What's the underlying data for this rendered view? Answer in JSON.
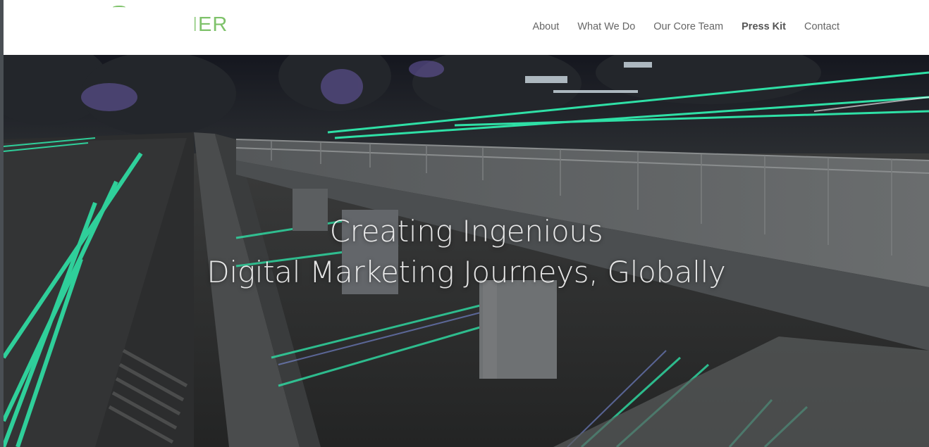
{
  "header": {
    "logo_text": "IER",
    "nav": [
      {
        "label": "About"
      },
      {
        "label": "What We Do"
      },
      {
        "label": "Our Core Team"
      },
      {
        "label": "Press Kit"
      },
      {
        "label": "Contact"
      }
    ]
  },
  "hero": {
    "line1": "Creating Ingenious",
    "line2": "Digital Marketing Journeys, Globally",
    "background": "night highway overpass with green light trails"
  },
  "colors": {
    "brand_green": "#7ec26a",
    "light_trail": "#2fe0a6",
    "nav_text": "#666666"
  }
}
